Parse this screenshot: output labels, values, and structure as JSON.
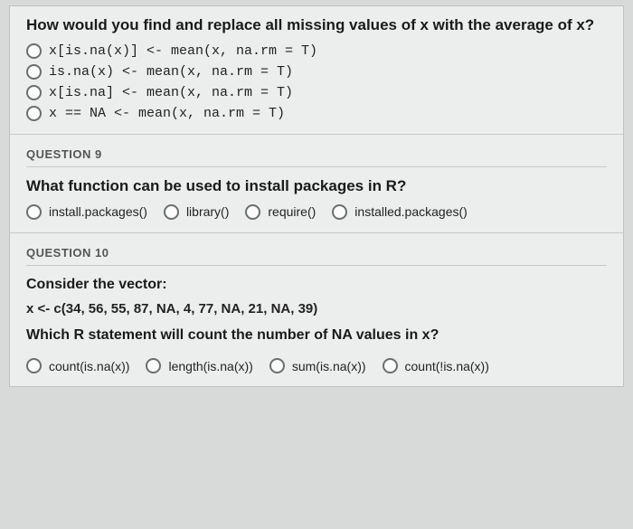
{
  "q8": {
    "prompt": "How would you find and replace all missing values of x with the average of x?",
    "options": [
      "x[is.na(x)] <- mean(x, na.rm = T)",
      "is.na(x) <- mean(x, na.rm = T)",
      "x[is.na] <- mean(x, na.rm = T)",
      "x == NA <- mean(x, na.rm = T)"
    ]
  },
  "q9": {
    "heading": "QUESTION 9",
    "prompt": "What function can be used to install packages in R?",
    "options": [
      "install.packages()",
      "library()",
      "require()",
      "installed.packages()"
    ]
  },
  "q10": {
    "heading": "QUESTION 10",
    "line1": "Consider the vector:",
    "vector": "x <- c(34, 56, 55, 87, NA, 4, 77, NA, 21, NA, 39)",
    "prompt": "Which R statement will count the number of NA values in x?",
    "options": [
      "count(is.na(x))",
      "length(is.na(x))",
      "sum(is.na(x))",
      "count(!is.na(x))"
    ]
  }
}
